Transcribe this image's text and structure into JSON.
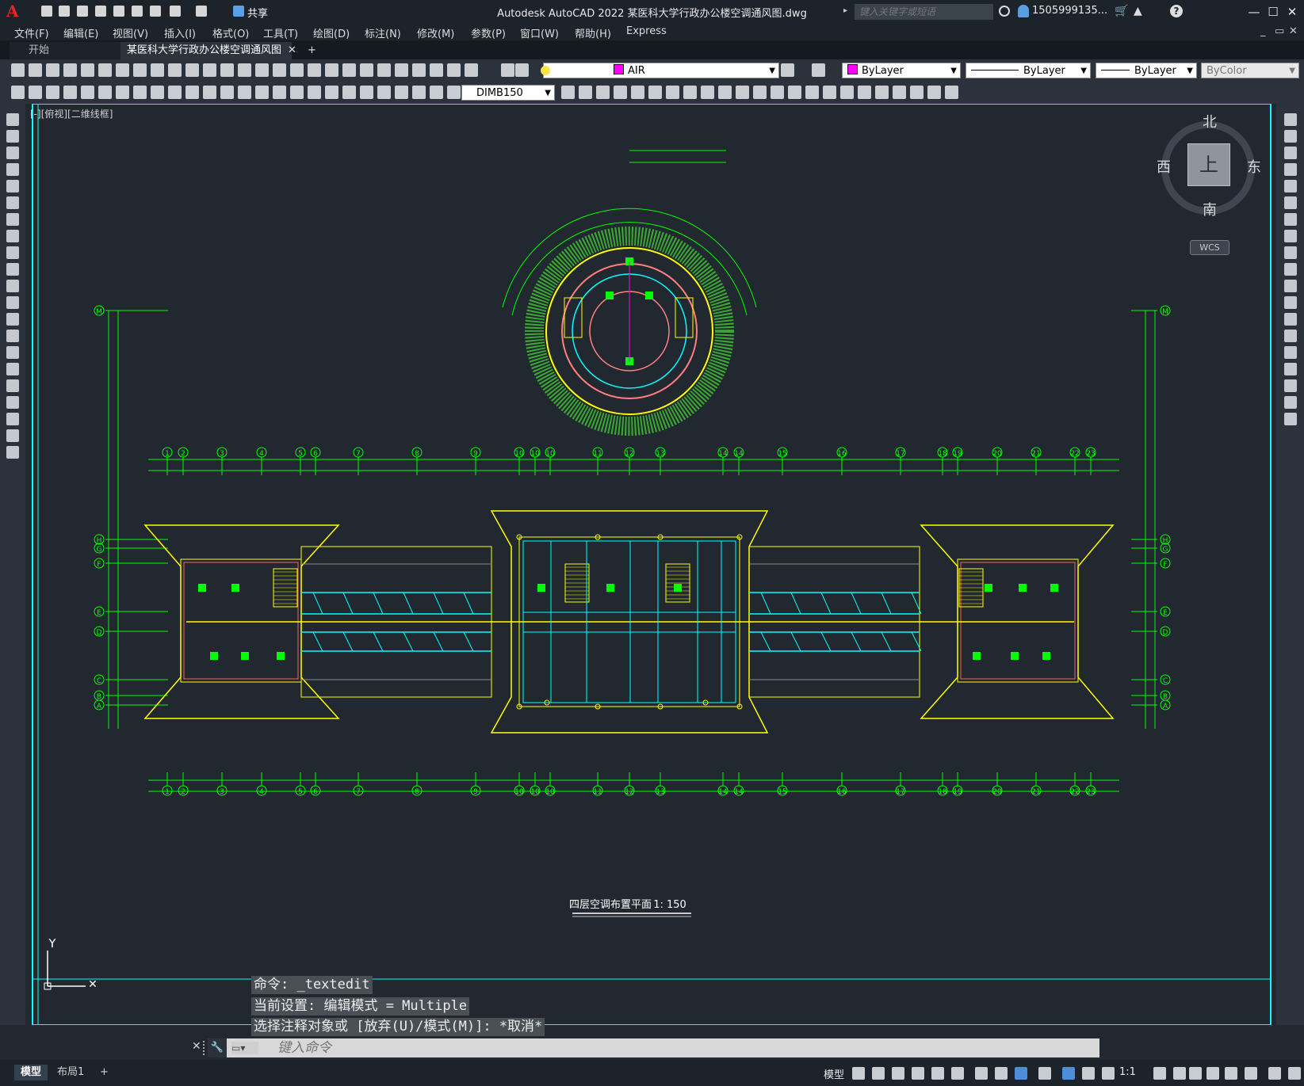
{
  "app": {
    "title": "Autodesk AutoCAD 2022    某医科大学行政办公楼空调通风图.dwg",
    "logo": "A",
    "share_label": "共享",
    "search_placeholder": "键入关键字或短语",
    "user": "1505999135...",
    "window_controls": [
      "minimize-icon",
      "restore-icon",
      "close-icon"
    ]
  },
  "menus": [
    "文件(F)",
    "编辑(E)",
    "视图(V)",
    "插入(I)",
    "格式(O)",
    "工具(T)",
    "绘图(D)",
    "标注(N)",
    "修改(M)",
    "参数(P)",
    "窗口(W)",
    "帮助(H)",
    "Express"
  ],
  "tabs": {
    "start": "开始",
    "active": "某医科大学行政办公楼空调通风图*",
    "add": "+"
  },
  "toolbar": {
    "layer": "AIR",
    "layer_color": "#ff00ff",
    "color_prop": "ByLayer",
    "linetype": "ByLayer",
    "lineweight": "ByLayer",
    "plotstyle": "ByColor",
    "dimstyle": "DIMB150"
  },
  "canvas": {
    "view_label": "[-][俯视][二维线框]",
    "viewcube": {
      "north": "北",
      "south": "南",
      "east": "东",
      "west": "西",
      "face": "上",
      "wcs": "WCS"
    },
    "drawing_title": "四层空调布置平面",
    "drawing_scale": "1: 150",
    "axis_numbers": [
      "1",
      "2",
      "3",
      "4",
      "5",
      "6",
      "7",
      "8",
      "9",
      "10",
      "10",
      "10",
      "11",
      "12",
      "13",
      "14",
      "14",
      "15",
      "16",
      "17",
      "18",
      "19",
      "20",
      "21",
      "22",
      "23"
    ],
    "axis_letters": [
      "M",
      "H",
      "G",
      "F",
      "E",
      "D",
      "C",
      "B",
      "A"
    ],
    "ucs_y": "Y"
  },
  "command": {
    "history": [
      "命令: _textedit",
      "当前设置: 编辑模式 = Multiple",
      "选择注释对象或 [放弃(U)/模式(M)]: *取消*"
    ],
    "placeholder": "键入命令"
  },
  "layout_tabs": [
    "模型",
    "布局1",
    "+"
  ],
  "status": {
    "model": "模型",
    "scale": "1:1"
  },
  "colors": {
    "background": "#212830",
    "green": "#00ff00",
    "yellow": "#ffff00",
    "cyan": "#00ffff",
    "magenta": "#ff00ff",
    "red": "#ff4040"
  }
}
